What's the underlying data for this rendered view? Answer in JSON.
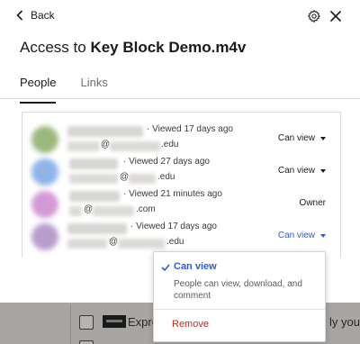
{
  "header": {
    "back_label": "Back",
    "title_prefix": "Access to",
    "file_name": "Key Block Demo.m4v"
  },
  "tabs": [
    {
      "label": "People",
      "active": true
    },
    {
      "label": "Links",
      "active": false
    }
  ],
  "people": [
    {
      "viewed": "Viewed 17 days ago",
      "email_at": "@",
      "email_domain": ".edu",
      "permission": "Can view",
      "avatar_color": "#9bb97e"
    },
    {
      "viewed": "Viewed 27 days ago",
      "email_at": "@",
      "email_domain": ".edu",
      "permission": "Can view",
      "avatar_color": "#8fb4e8"
    },
    {
      "viewed": "Viewed 21 minutes ago",
      "email_at": "@",
      "email_domain": ".com",
      "permission": "Owner",
      "avatar_color": "#d49ad6"
    },
    {
      "viewed": "Viewed 17 days ago",
      "email_at": "@",
      "email_domain": ".edu",
      "permission": "Can view",
      "avatar_color": "#b89dcc"
    }
  ],
  "dropdown": {
    "can_view_label": "Can view",
    "can_view_desc": "People can view, download, and comment",
    "remove_label": "Remove"
  },
  "background": {
    "row_text": "Expre",
    "row_right": "ly you"
  },
  "colors": {
    "accent_blue": "#2e5ad6",
    "danger_red": "#c4291d"
  }
}
